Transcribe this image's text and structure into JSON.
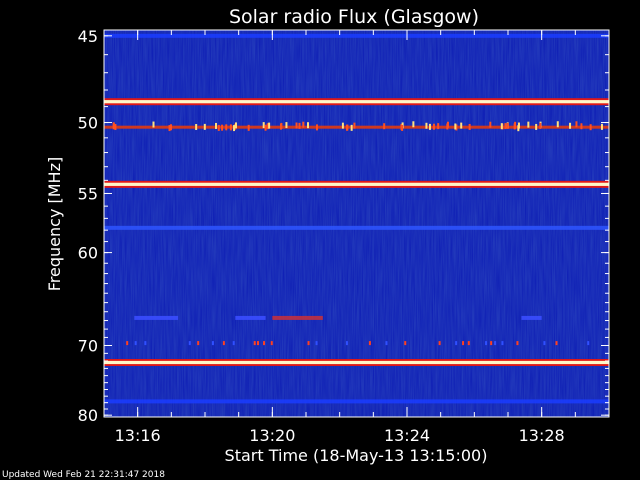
{
  "chart_data": {
    "type": "heatmap",
    "title": "Solar radio Flux (Glasgow)",
    "xlabel": "Start Time (18-May-13 13:15:00)",
    "ylabel": "Frequency [MHz]",
    "x_range_minutes": [
      0.0,
      15.0
    ],
    "x_ticks": [
      {
        "minute": 1.0,
        "label": "13:16"
      },
      {
        "minute": 5.0,
        "label": "13:20"
      },
      {
        "minute": 9.0,
        "label": "13:24"
      },
      {
        "minute": 13.0,
        "label": "13:28"
      }
    ],
    "y_range_mhz": [
      44.7,
      80.3
    ],
    "y_ticks": [
      {
        "mhz": 45,
        "label": "45"
      },
      {
        "mhz": 50,
        "label": "50"
      },
      {
        "mhz": 55,
        "label": "55"
      },
      {
        "mhz": 60,
        "label": "60"
      },
      {
        "mhz": 70,
        "label": "70"
      },
      {
        "mhz": 80,
        "label": "80"
      }
    ],
    "y_scale": "reciprocal",
    "colormap": {
      "low": "#0a1aa8",
      "mid": "#c01010",
      "high": "#ffffe0"
    },
    "bands": [
      {
        "mhz": 45.0,
        "intensity": "low",
        "color": "#1a3cff"
      },
      {
        "mhz": 48.7,
        "intensity": "high",
        "color": "#fff7c8"
      },
      {
        "mhz": 50.3,
        "intensity": "mid",
        "color": "#e23a10"
      },
      {
        "mhz": 54.3,
        "intensity": "high",
        "color": "#fff7c8"
      },
      {
        "mhz": 57.8,
        "intensity": "low",
        "color": "#2e55ff"
      },
      {
        "mhz": 72.2,
        "intensity": "high",
        "color": "#fff7c8"
      },
      {
        "mhz": 77.8,
        "intensity": "low",
        "color": "#1a3cff"
      }
    ],
    "footer": "Updated Wed Feb 21 22:31:47 2018"
  }
}
